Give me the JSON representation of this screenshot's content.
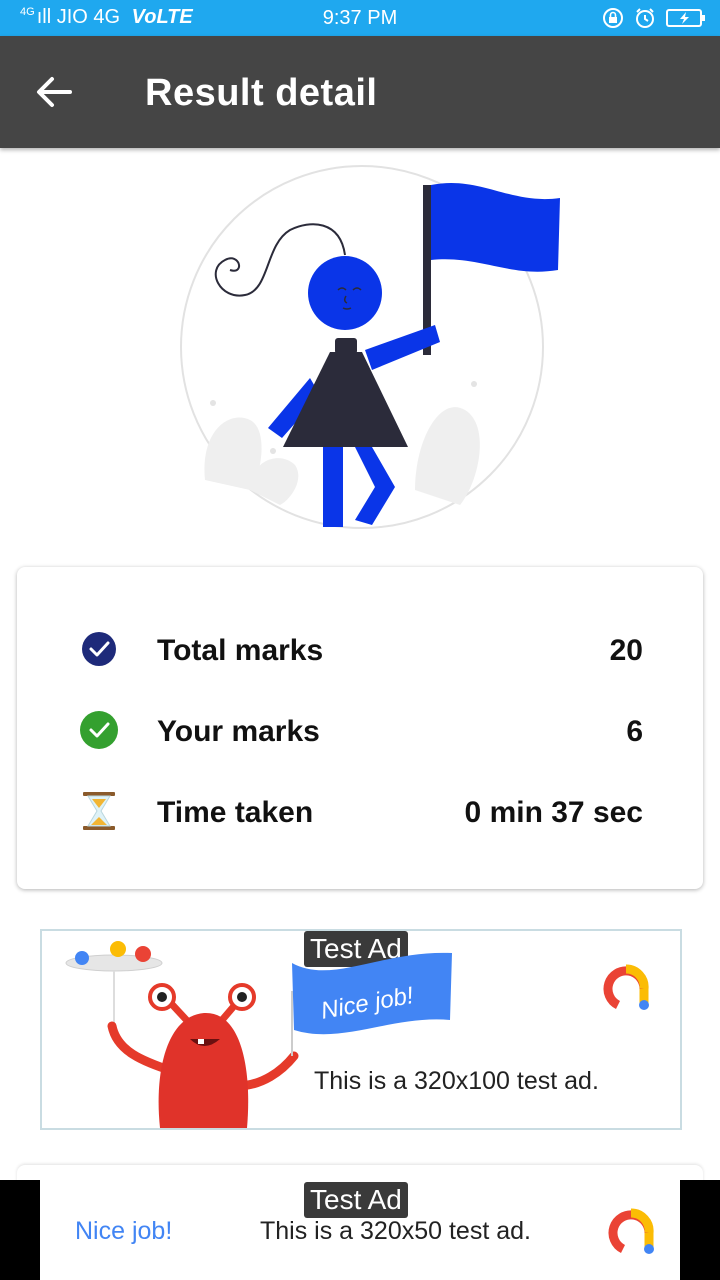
{
  "status_bar": {
    "signal_tag": "4G",
    "carrier": "JIO 4G",
    "volte": "VoLTE",
    "time": "9:37 PM",
    "icons": [
      "lock-rotation-icon",
      "alarm-icon",
      "battery-charging-icon"
    ]
  },
  "app_bar": {
    "back_icon": "arrow-left-icon",
    "title": "Result detail"
  },
  "result": {
    "rows": [
      {
        "icon": "check-circle-navy-icon",
        "label": "Total marks",
        "value": "20"
      },
      {
        "icon": "check-circle-green-icon",
        "label": "Your marks",
        "value": "6"
      },
      {
        "icon": "hourglass-icon",
        "label": "Time taken",
        "value": "0 min 37 sec"
      }
    ]
  },
  "ad_top": {
    "tag": "Test Ad",
    "flag_text": "Nice job!",
    "text": "This is a 320x100 test ad."
  },
  "ad_bottom": {
    "tag": "Test Ad",
    "nice": "Nice job!",
    "text": "This is a 320x50 test ad."
  },
  "colors": {
    "status_bar": "#1fa8ef",
    "app_bar": "#454545",
    "figure_blue": "#0a35e8",
    "navy": "#1e2a7a",
    "green": "#34a02f",
    "ad_blue": "#4285f4"
  }
}
